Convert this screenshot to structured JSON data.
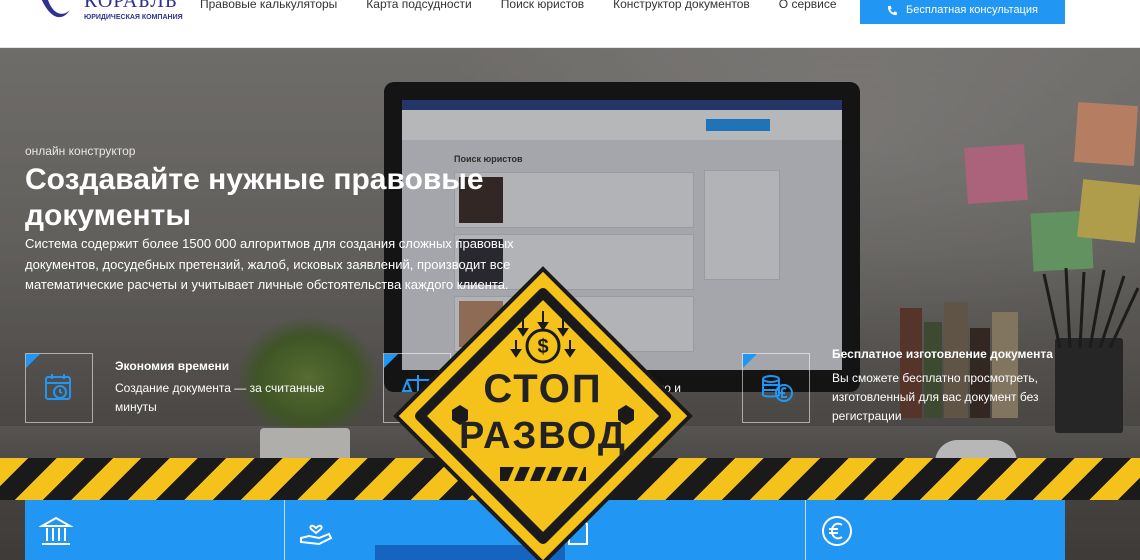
{
  "header": {
    "logo": {
      "title": "КОРАБЛЬ",
      "subtitle": "ЮРИДИЧЕСКАЯ КОМПАНИЯ"
    },
    "nav": [
      {
        "label": "Правовые калькуляторы"
      },
      {
        "label": "Карта подсудности"
      },
      {
        "label": "Поиск юристов"
      },
      {
        "label": "Конструктор документов"
      },
      {
        "label": "О сервисе"
      }
    ],
    "cta_label": "Бесплатная консультация"
  },
  "hero": {
    "eyebrow": "онлайн конструктор",
    "title": "Создавайте нужные правовые документы",
    "lead": "Система содержит более 1500 000 алгоритмов для создания сложных правовых документов, досудебных претензий, жалоб, исковых заявлений, производит все математические расчеты и учитывает личные обстоятельства каждого клиента.",
    "screen_title": "Поиск юристов"
  },
  "features": [
    {
      "icon": "calendar-clock-icon",
      "title": "Экономия времени",
      "text": "Создание документа — за считанные минуты"
    },
    {
      "icon": "scales-icon",
      "title": "",
      "text": "во и"
    },
    {
      "icon": "coins-pound-icon",
      "title": "Бесплатное изготовление документа",
      "text": "Вы сможете бесплатно просмотреть, изготовленный для вас документ без регистрации"
    }
  ],
  "stamp": {
    "line1": "СТОП",
    "line2": "РАЗВОД"
  },
  "cards": [
    {
      "icon": "bank-icon"
    },
    {
      "icon": "hand-heart-icon"
    },
    {
      "icon": "document-icon"
    },
    {
      "icon": "euro-icon"
    }
  ],
  "colors": {
    "accent": "#2196f3",
    "brand": "#2e3192",
    "hazard_yellow": "#f4c21a"
  }
}
